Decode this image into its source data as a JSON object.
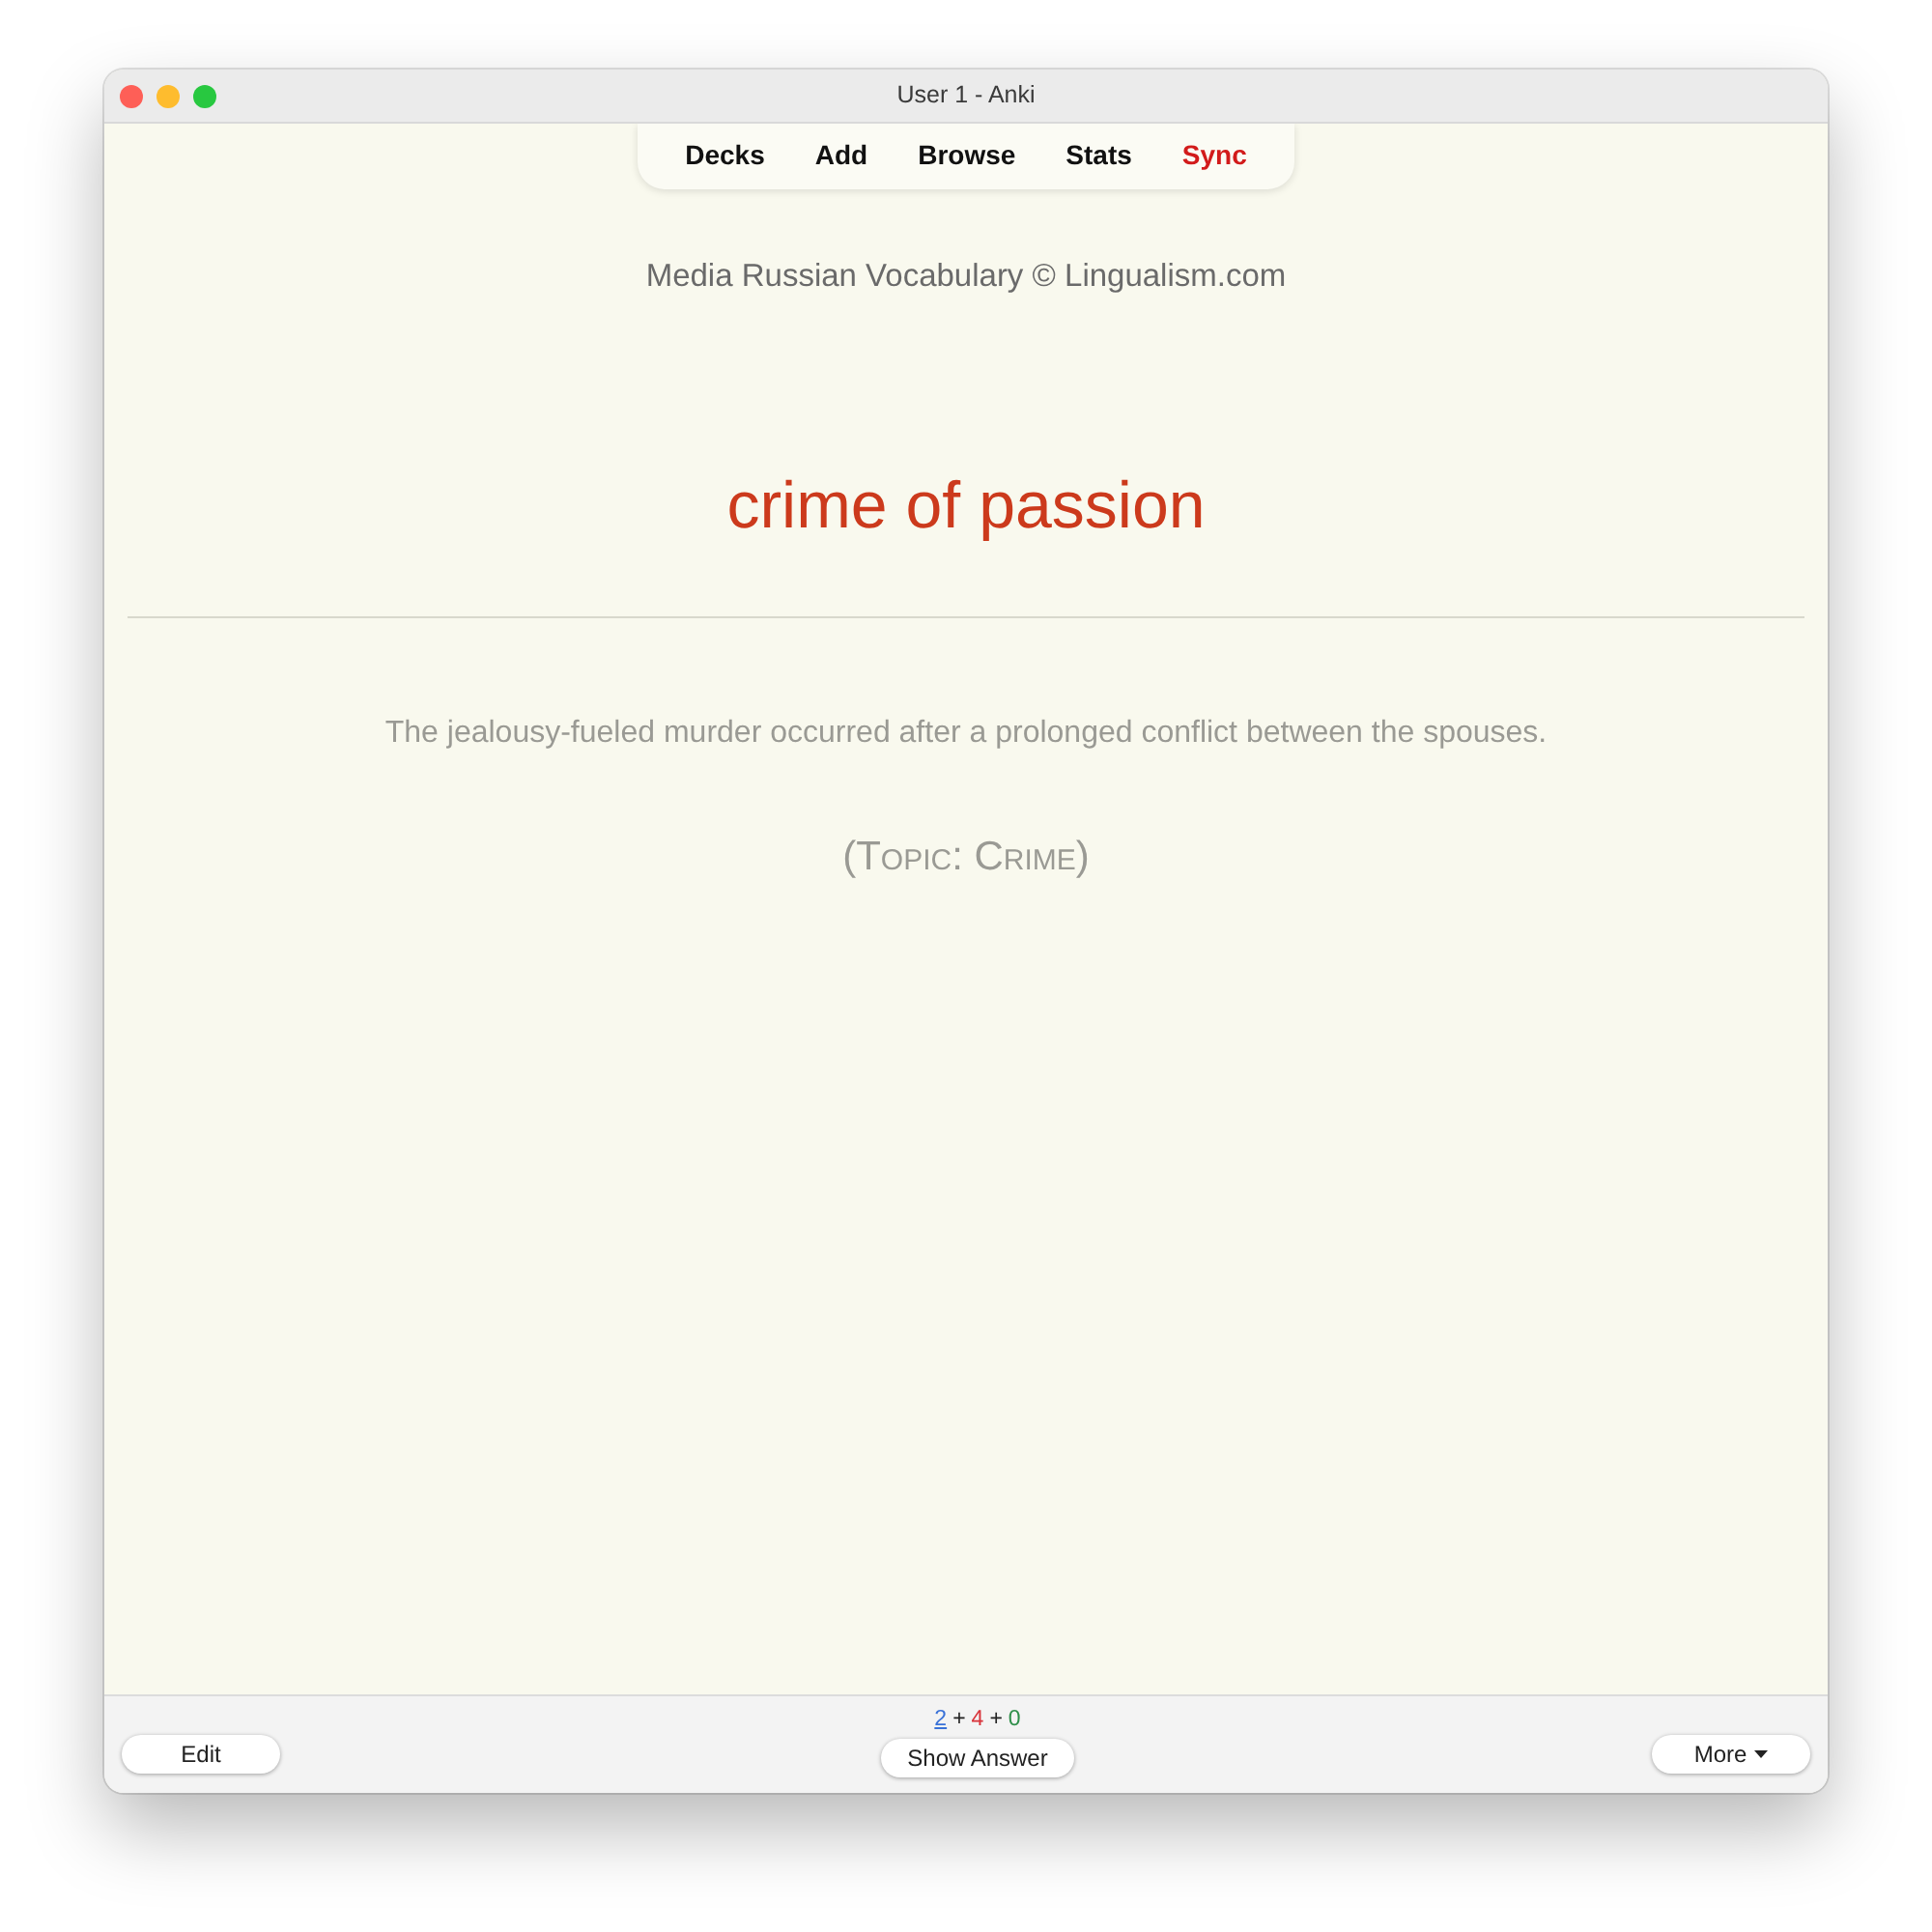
{
  "window": {
    "title": "User 1 - Anki"
  },
  "toolbar": {
    "items": [
      {
        "label": "Decks",
        "highlighted": false
      },
      {
        "label": "Add",
        "highlighted": false
      },
      {
        "label": "Browse",
        "highlighted": false
      },
      {
        "label": "Stats",
        "highlighted": false
      },
      {
        "label": "Sync",
        "highlighted": true
      }
    ]
  },
  "card": {
    "deck_credit": "Media Russian Vocabulary © Lingualism.com",
    "front": "crime of passion",
    "example": "The jealousy-fueled murder occurred after a prolonged conflict between the spouses.",
    "topic": "(Topic: Crime)"
  },
  "bottom_bar": {
    "edit_button": "Edit",
    "counts": [
      {
        "kind": "count",
        "text": "2",
        "color": "#3a72d8",
        "current": true
      },
      {
        "kind": "separator",
        "text": "+"
      },
      {
        "kind": "count",
        "text": "4",
        "color": "#d8333a",
        "current": false
      },
      {
        "kind": "separator",
        "text": "+"
      },
      {
        "kind": "count",
        "text": "0",
        "color": "#2f8f4a",
        "current": false
      }
    ],
    "show_answer_button": "Show Answer",
    "more_button": "More"
  }
}
